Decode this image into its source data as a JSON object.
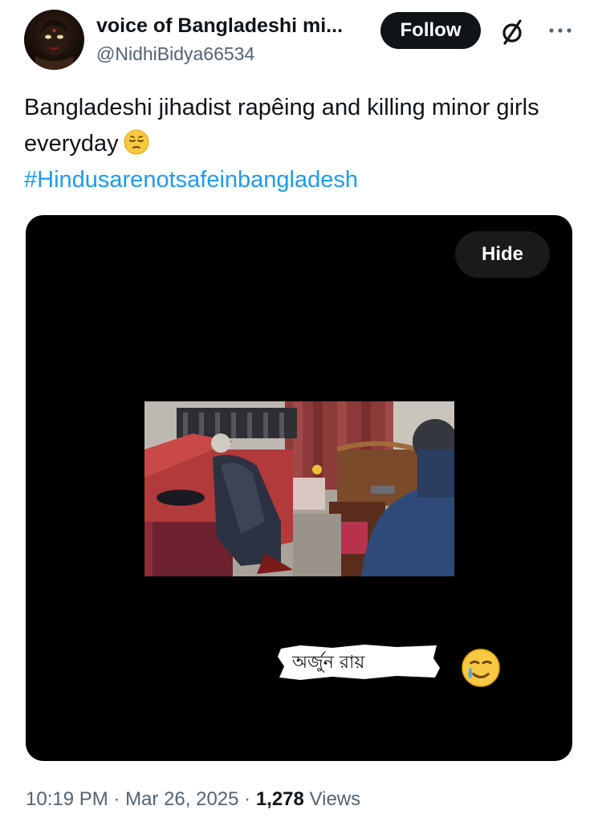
{
  "author": {
    "display_name": "voice of Bangladeshi mi...",
    "handle": "@NidhiBidya66534"
  },
  "header": {
    "follow_label": "Follow"
  },
  "tweet": {
    "text": "Bangladeshi jihadist rapêing and killing minor girls everyday",
    "hashtag": "#Hindusarenotsafeinbangladesh"
  },
  "media": {
    "hide_label": "Hide",
    "caption": "অর্জুন রায়"
  },
  "meta": {
    "time": "10:19 PM",
    "sep1": " · ",
    "date": "Mar 26, 2025",
    "sep2": " · ",
    "views_count": "1,278",
    "views_label": " Views"
  },
  "icons": {
    "header": [
      "grok-icon",
      "more-icon"
    ],
    "inline": [
      "pensive-face-emoji",
      "crying-smile-emoji"
    ]
  },
  "colors": {
    "text": "#0f1419",
    "secondary": "#536471",
    "link": "#1d9bf0",
    "button_dark": "#0f1419"
  }
}
